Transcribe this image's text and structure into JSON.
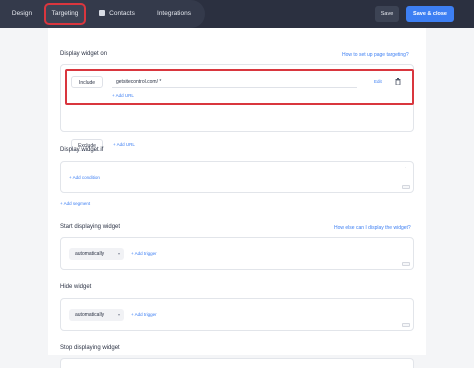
{
  "topbar": {
    "tabs": [
      {
        "label": "Design"
      },
      {
        "label": "Targeting"
      },
      {
        "label": "Contacts"
      },
      {
        "label": "Integrations"
      }
    ],
    "save_label": "Save",
    "save_close_label": "Save & close"
  },
  "display_on": {
    "label": "Display widget on",
    "help_link": "How to set up page targeting?",
    "include_label": "Include",
    "include_url": "getsitecontrol.com/ *",
    "edit_label": "Edit",
    "add_url_label": "+ Add URL",
    "exclude_label": "Exclude",
    "exclude_add_url_label": "+ Add URL"
  },
  "display_if": {
    "label": "Display widget if",
    "add_condition_label": "+ Add condition",
    "add_segment_label": "+ Add segment"
  },
  "start_display": {
    "label": "Start displaying widget",
    "help_link": "How else can I display the widget?",
    "mode_value": "automatically",
    "add_trigger_label": "+ Add trigger"
  },
  "hide_widget": {
    "label": "Hide widget",
    "mode_value": "automatically",
    "add_trigger_label": "+ Add trigger"
  },
  "stop_display": {
    "label": "Stop displaying widget"
  },
  "colors": {
    "topbar": "#2b3040",
    "accent": "#3d7ff3",
    "highlight": "#d9363e"
  }
}
